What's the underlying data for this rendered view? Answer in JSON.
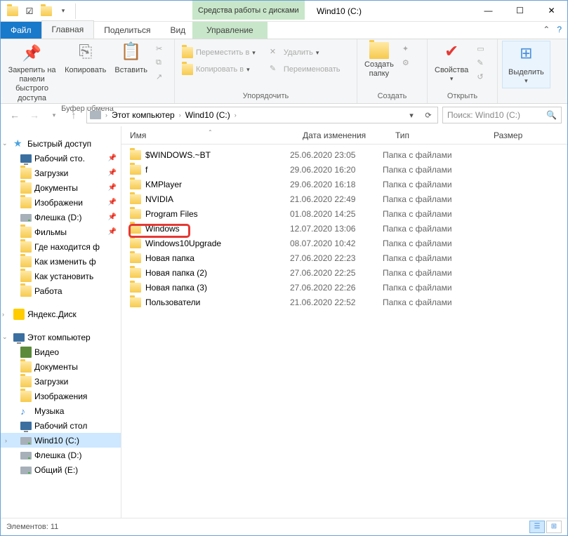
{
  "title": "Wind10 (C:)",
  "diskTools": {
    "header": "Средства работы с дисками",
    "tab": "Управление"
  },
  "ribbonTabs": {
    "file": "Файл",
    "home": "Главная",
    "share": "Поделиться",
    "view": "Вид"
  },
  "ribbon": {
    "pin": "Закрепить на панели\nбыстрого доступа",
    "copy": "Копировать",
    "paste": "Вставить",
    "clipboardGroup": "Буфер обмена",
    "moveTo": "Переместить в",
    "copyTo": "Копировать в",
    "delete": "Удалить",
    "rename": "Переименовать",
    "organizeGroup": "Упорядочить",
    "newFolder": "Создать\nпапку",
    "newGroup": "Создать",
    "properties": "Свойства",
    "openGroup": "Открыть",
    "select": "Выделить",
    "selectGroup": " "
  },
  "breadcrumb": {
    "root": "Этот компьютер",
    "drive": "Wind10 (C:)"
  },
  "search": {
    "placeholder": "Поиск: Wind10 (C:)"
  },
  "columns": {
    "name": "Имя",
    "date": "Дата изменения",
    "type": "Тип",
    "size": "Размер"
  },
  "nav": {
    "quickAccess": "Быстрый доступ",
    "items1": [
      {
        "label": "Рабочий сто.",
        "icon": "monitor",
        "pin": true
      },
      {
        "label": "Загрузки",
        "icon": "folder",
        "pin": true
      },
      {
        "label": "Документы",
        "icon": "folder",
        "pin": true
      },
      {
        "label": "Изображени",
        "icon": "folder",
        "pin": true
      },
      {
        "label": "Флешка (D:)",
        "icon": "drive",
        "pin": true
      },
      {
        "label": "Фильмы",
        "icon": "folder",
        "pin": true
      },
      {
        "label": "Где находится ф",
        "icon": "folder"
      },
      {
        "label": "Как изменить ф",
        "icon": "folder"
      },
      {
        "label": "Как установить",
        "icon": "folder"
      },
      {
        "label": "Работа",
        "icon": "folder"
      }
    ],
    "yandex": "Яндекс.Диск",
    "thisPC": "Этот компьютер",
    "pcItems": [
      {
        "label": "Видео",
        "icon": "video"
      },
      {
        "label": "Документы",
        "icon": "folder"
      },
      {
        "label": "Загрузки",
        "icon": "folder"
      },
      {
        "label": "Изображения",
        "icon": "folder"
      },
      {
        "label": "Музыка",
        "icon": "music"
      },
      {
        "label": "Рабочий стол",
        "icon": "monitor"
      },
      {
        "label": "Wind10 (C:)",
        "icon": "drive",
        "selected": true
      },
      {
        "label": "Флешка (D:)",
        "icon": "drive"
      },
      {
        "label": "Общий (E:)",
        "icon": "drive"
      }
    ]
  },
  "files": [
    {
      "name": "$WINDOWS.~BT",
      "date": "25.06.2020 23:05",
      "type": "Папка с файлами"
    },
    {
      "name": "f",
      "date": "29.06.2020 16:20",
      "type": "Папка с файлами"
    },
    {
      "name": "KMPlayer",
      "date": "29.06.2020 16:18",
      "type": "Папка с файлами"
    },
    {
      "name": "NVIDIA",
      "date": "21.06.2020 22:49",
      "type": "Папка с файлами"
    },
    {
      "name": "Program Files",
      "date": "01.08.2020 14:25",
      "type": "Папка с файлами"
    },
    {
      "name": "Windows",
      "date": "12.07.2020 13:06",
      "type": "Папка с файлами",
      "highlight": true
    },
    {
      "name": "Windows10Upgrade",
      "date": "08.07.2020 10:42",
      "type": "Папка с файлами"
    },
    {
      "name": "Новая папка",
      "date": "27.06.2020 22:23",
      "type": "Папка с файлами"
    },
    {
      "name": "Новая папка (2)",
      "date": "27.06.2020 22:25",
      "type": "Папка с файлами"
    },
    {
      "name": "Новая папка (3)",
      "date": "27.06.2020 22:26",
      "type": "Папка с файлами"
    },
    {
      "name": "Пользователи",
      "date": "21.06.2020 22:52",
      "type": "Папка с файлами"
    }
  ],
  "status": {
    "count": "Элементов: 11"
  }
}
